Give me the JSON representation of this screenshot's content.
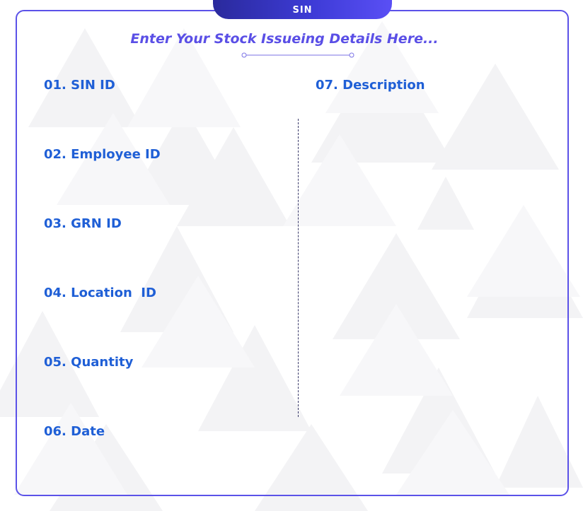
{
  "header": {
    "tab_label": "SIN",
    "title": "Enter Your Stock Issueing Details Here..."
  },
  "fields": {
    "left": [
      "01. SIN ID",
      "02. Employee ID",
      "03. GRN ID",
      "04. Location  ID",
      "05. Quantity",
      "06. Date"
    ],
    "right": [
      "07. Description"
    ]
  },
  "colors": {
    "accent": "#5b52e8",
    "label": "#1f5fd6",
    "title": "#5a4fe6",
    "tab_dark": "#2a2a9c",
    "tab_light": "#5a4ff5"
  }
}
